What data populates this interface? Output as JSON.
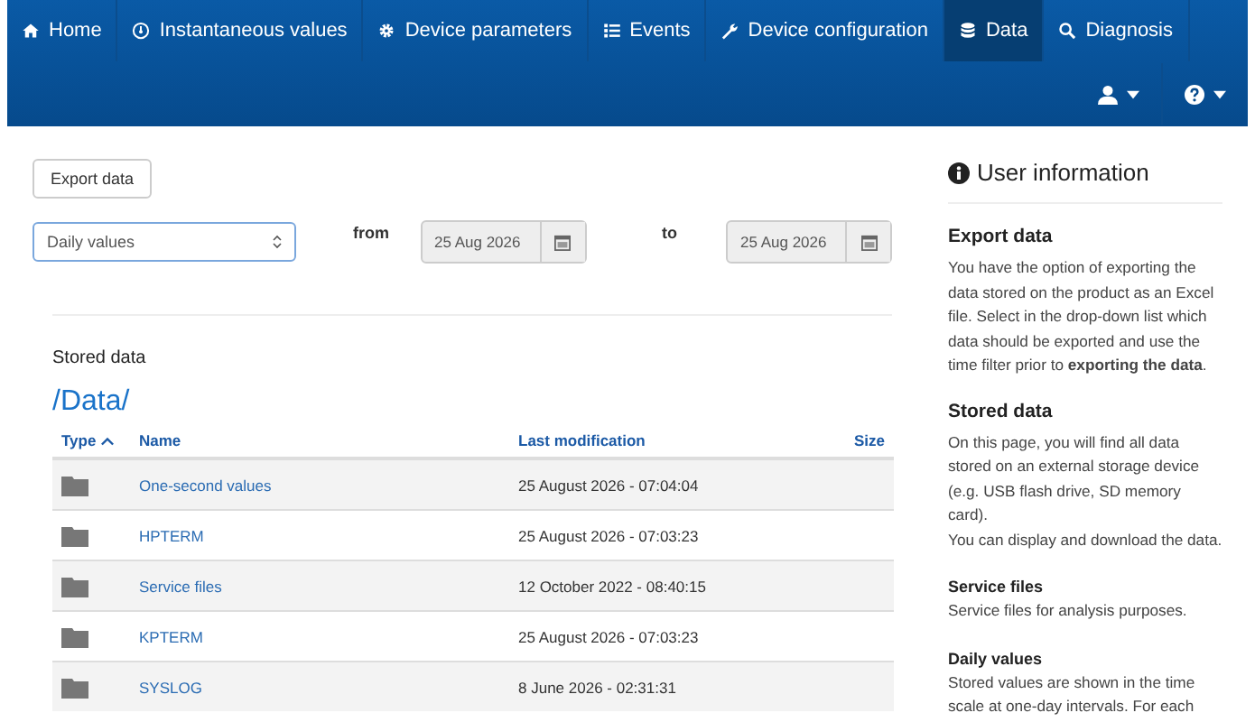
{
  "nav": {
    "tabs": [
      {
        "label": "Home",
        "selected": false
      },
      {
        "label": "Instantaneous values",
        "selected": false
      },
      {
        "label": "Device parameters",
        "selected": false
      },
      {
        "label": "Events",
        "selected": false
      },
      {
        "label": "Device configuration",
        "selected": false
      },
      {
        "label": "Data",
        "selected": true
      },
      {
        "label": "Diagnosis",
        "selected": false
      }
    ]
  },
  "toolbar": {
    "export_button": "Export data",
    "select": {
      "value": "Daily values"
    },
    "from_label": "from",
    "from_date": "25 Aug 2026",
    "to_label": "to",
    "to_date": "25 Aug 2026"
  },
  "stored_data": {
    "title": "Stored data",
    "path": "/Data/",
    "columns": [
      "Type",
      "Name",
      "Last modification",
      "Size"
    ],
    "rows": [
      {
        "name": "One-second values",
        "modified": "25 August 2026 - 07:04:04"
      },
      {
        "name": "HPTERM",
        "modified": "25 August 2026 - 07:03:23"
      },
      {
        "name": "Service files",
        "modified": "12 October 2022 - 08:40:15"
      },
      {
        "name": "KPTERM",
        "modified": "25 August 2026 - 07:03:23"
      },
      {
        "name": "SYSLOG",
        "modified": "8 June 2026 - 02:31:31"
      }
    ]
  },
  "user_information": {
    "title": "User information",
    "sections": [
      {
        "kind": "major",
        "heading": "Export data",
        "paragraphs": [
          "You have the option of exporting the data stored on the product as an Excel file. Select in the drop-down list which data should be exported and use the time filter prior to **exporting the data**."
        ]
      },
      {
        "kind": "major",
        "heading": "Stored data",
        "paragraphs": [
          "On this page, you will find all data stored on an external storage device (e.g. USB flash drive, SD memory card).",
          "You can display and download the data."
        ]
      },
      {
        "kind": "minor",
        "heading": "Service files",
        "paragraphs": [
          "Service files for analysis purposes."
        ]
      },
      {
        "kind": "minor",
        "heading": "Daily values",
        "paragraphs": [
          "Stored values are shown in the time scale at one-day intervals. For each"
        ]
      }
    ]
  }
}
